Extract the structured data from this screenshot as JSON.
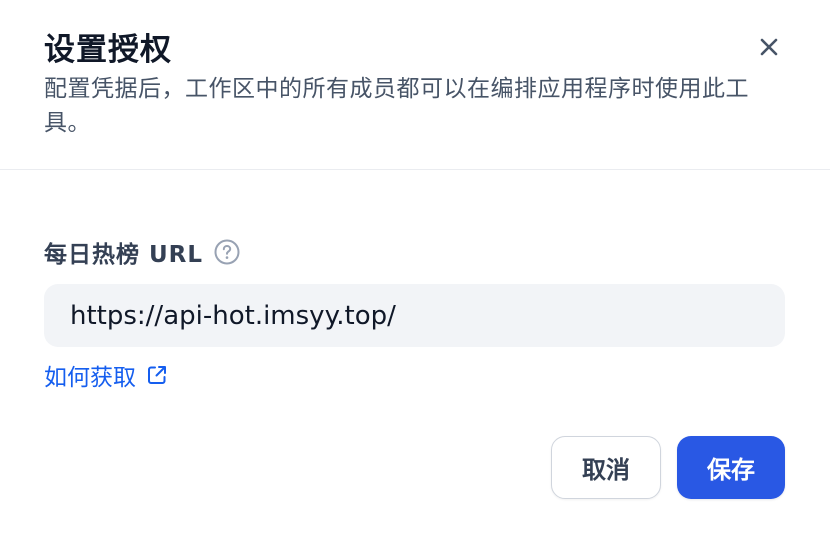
{
  "dialog": {
    "title": "设置授权",
    "description": "配置凭据后，工作区中的所有成员都可以在编排应用程序时使用此工具。",
    "close_icon": "close-icon"
  },
  "form": {
    "field_label": "每日热榜 URL",
    "help_icon": "question-circle-icon",
    "url_value": "https://api-hot.imsyy.top/",
    "help_link_label": "如何获取",
    "help_link_icon": "external-link-icon"
  },
  "actions": {
    "cancel_label": "取消",
    "save_label": "保存"
  },
  "colors": {
    "primary": "#2958e4",
    "link": "#155eef",
    "input_bg": "#f2f4f7"
  }
}
